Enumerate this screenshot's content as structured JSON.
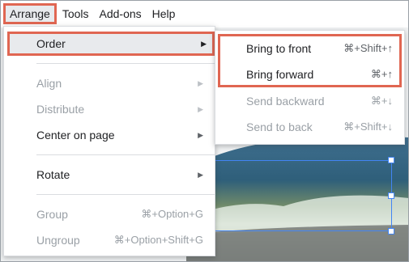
{
  "menubar": {
    "items": [
      "Arrange",
      "Tools",
      "Add-ons",
      "Help"
    ]
  },
  "arrange_menu": {
    "order": "Order",
    "align": "Align",
    "distribute": "Distribute",
    "center_on_page": "Center on page",
    "rotate": "Rotate",
    "group": "Group",
    "group_shortcut": "⌘+Option+G",
    "ungroup": "Ungroup",
    "ungroup_shortcut": "⌘+Option+Shift+G"
  },
  "order_submenu": {
    "items": [
      {
        "label": "Bring to front",
        "shortcut": "⌘+Shift+↑",
        "enabled": true
      },
      {
        "label": "Bring forward",
        "shortcut": "⌘+↑",
        "enabled": true
      },
      {
        "label": "Send backward",
        "shortcut": "⌘+↓",
        "enabled": false
      },
      {
        "label": "Send to back",
        "shortcut": "⌘+Shift+↓",
        "enabled": false
      }
    ]
  },
  "icons": {
    "submenu_arrow": "triangle-right-icon"
  },
  "colors": {
    "highlight_border": "#e06652",
    "hover_bg": "#e8eaed",
    "selection": "#4285f4",
    "disabled_text": "#9aa0a6"
  }
}
